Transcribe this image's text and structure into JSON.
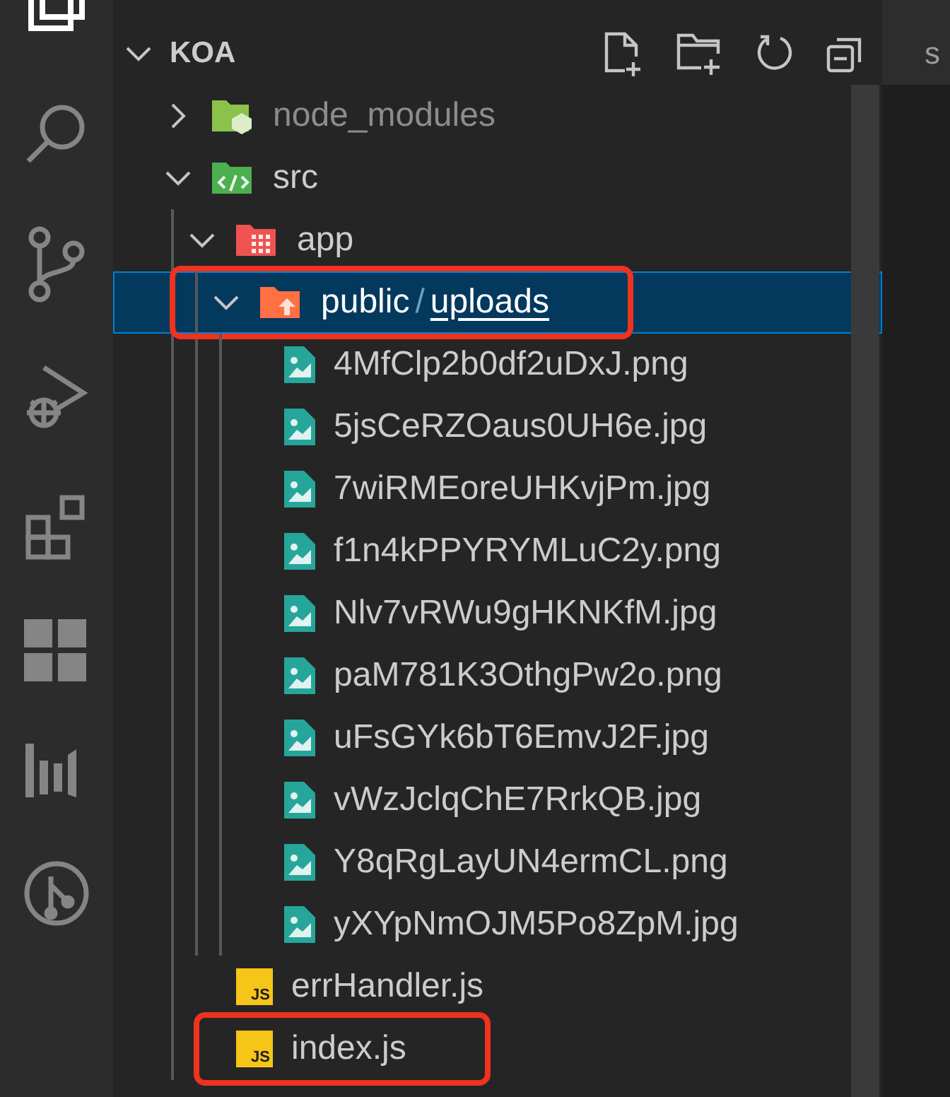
{
  "explorer": {
    "title": "KOA",
    "expanded": true,
    "tree": [
      {
        "kind": "node_folder",
        "label": "node_modules",
        "expanded": false,
        "dimmed": true,
        "selected": false,
        "highlighted": false
      },
      {
        "kind": "src_folder",
        "label": "src",
        "expanded": true,
        "dimmed": false,
        "selected": false,
        "highlighted": false,
        "children": [
          {
            "kind": "app_folder",
            "label": "app",
            "expanded": true,
            "dimmed": false,
            "selected": false,
            "highlighted": false,
            "children": [
              {
                "kind": "public_folder",
                "segments": [
                  {
                    "text": "public",
                    "focused": false
                  },
                  {
                    "text": "uploads",
                    "focused": true
                  }
                ],
                "separator": "/",
                "expanded": true,
                "dimmed": false,
                "selected": true,
                "highlighted": true,
                "children": [
                  {
                    "kind": "image",
                    "label": "4MfClp2b0df2uDxJ.png",
                    "dimmed": false,
                    "selected": false,
                    "highlighted": false
                  },
                  {
                    "kind": "image",
                    "label": "5jsCeRZOaus0UH6e.jpg",
                    "dimmed": false,
                    "selected": false,
                    "highlighted": false
                  },
                  {
                    "kind": "image",
                    "label": "7wiRMEoreUHKvjPm.jpg",
                    "dimmed": false,
                    "selected": false,
                    "highlighted": false
                  },
                  {
                    "kind": "image",
                    "label": "f1n4kPPYRYMLuC2y.png",
                    "dimmed": false,
                    "selected": false,
                    "highlighted": false
                  },
                  {
                    "kind": "image",
                    "label": "Nlv7vRWu9gHKNKfM.jpg",
                    "dimmed": false,
                    "selected": false,
                    "highlighted": false
                  },
                  {
                    "kind": "image",
                    "label": "paM781K3OthgPw2o.png",
                    "dimmed": false,
                    "selected": false,
                    "highlighted": false
                  },
                  {
                    "kind": "image",
                    "label": "uFsGYk6bT6EmvJ2F.jpg",
                    "dimmed": false,
                    "selected": false,
                    "highlighted": false
                  },
                  {
                    "kind": "image",
                    "label": "vWzJclqChE7RrkQB.jpg",
                    "dimmed": false,
                    "selected": false,
                    "highlighted": false
                  },
                  {
                    "kind": "image",
                    "label": "Y8qRgLayUN4ermCL.png",
                    "dimmed": false,
                    "selected": false,
                    "highlighted": false
                  },
                  {
                    "kind": "image",
                    "label": "yXYpNmOJM5Po8ZpM.jpg",
                    "dimmed": false,
                    "selected": false,
                    "highlighted": false
                  }
                ]
              }
            ]
          },
          {
            "kind": "js",
            "badge": "JS",
            "label": "errHandler.js",
            "dimmed": false,
            "selected": false,
            "highlighted": false
          },
          {
            "kind": "js",
            "badge": "JS",
            "label": "index.js",
            "dimmed": false,
            "selected": false,
            "highlighted": true
          }
        ]
      }
    ]
  },
  "editor": {
    "tabs": [
      {
        "label": "s"
      }
    ]
  }
}
